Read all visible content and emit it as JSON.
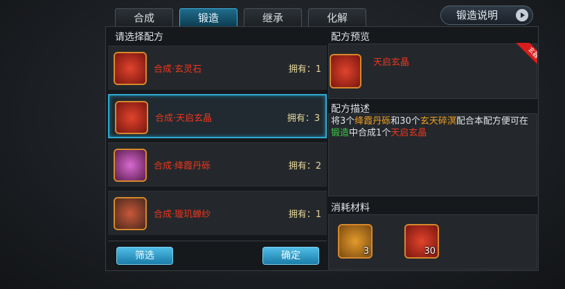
{
  "tabs": [
    "合成",
    "锻造",
    "继承",
    "化解"
  ],
  "active_tab": "锻造",
  "help_button": "锻造说明",
  "left_panel": {
    "title": "请选择配方",
    "items": [
      {
        "name": "合成·玄灵石",
        "owned": "拥有：1",
        "icon": "scroll-red-icon"
      },
      {
        "name": "合成·天启玄晶",
        "owned": "拥有：3",
        "icon": "scroll-red-icon"
      },
      {
        "name": "合成·绛霞丹砾",
        "owned": "拥有：2",
        "icon": "scroll-purple-icon"
      },
      {
        "name": "合成·璇玑蝉纱",
        "owned": "拥有：1",
        "icon": "scroll-mixed-icon"
      }
    ],
    "filter_button": "筛选",
    "confirm_button": "确定"
  },
  "preview": {
    "title": "配方预览",
    "item_name": "天启玄晶",
    "corner_tag": "玄器"
  },
  "description": {
    "title": "配方描述",
    "parts": [
      "将3个",
      "绛霞丹砾",
      "和30个",
      "玄天碎溟",
      "配合本配方便可在",
      "锻造",
      "中合成1个",
      "天启玄晶"
    ]
  },
  "materials": {
    "title": "消耗材料",
    "items": [
      {
        "count": "3",
        "icon": "material-gold-icon"
      },
      {
        "count": "30",
        "icon": "material-red-icon"
      }
    ]
  },
  "colors": {
    "accent": "#2fa9cf",
    "highlight_red": "#f0361e",
    "highlight_orange": "#f2a020",
    "highlight_green": "#3dcb4a"
  }
}
